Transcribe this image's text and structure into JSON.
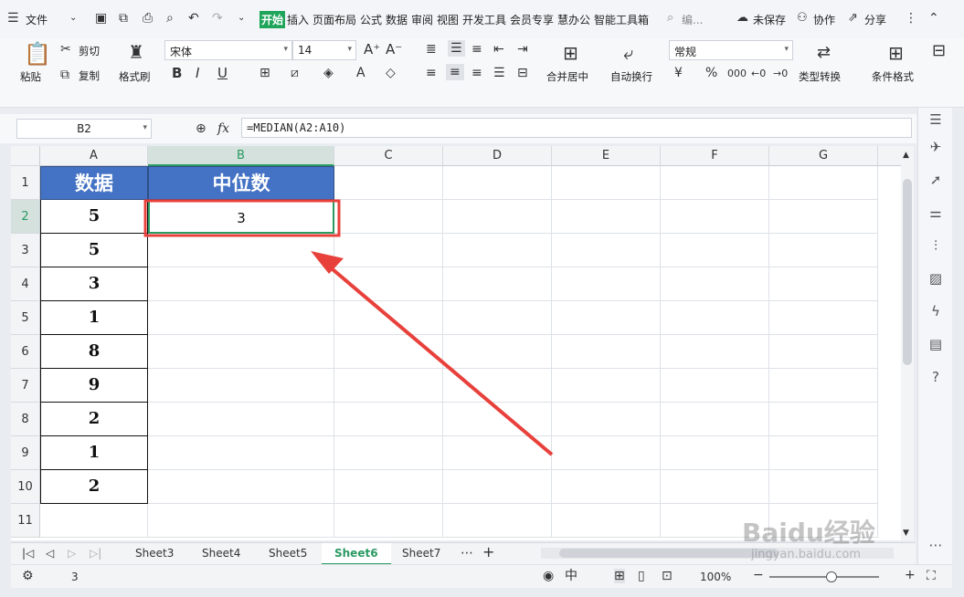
{
  "menubar": {
    "file_label": "文件",
    "tabs": [
      "开始",
      "插入",
      "页面布局",
      "公式",
      "数据",
      "审阅",
      "视图",
      "开发工具",
      "会员专享",
      "慧办公",
      "智能工具箱"
    ],
    "search_label": "编...",
    "unsaved_label": "未保存",
    "collab_label": "协作",
    "share_label": "分享"
  },
  "ribbon": {
    "paste": "粘贴",
    "cut": "剪切",
    "copy": "复制",
    "format_painter": "格式刷",
    "font_name": "宋体",
    "font_size": "14",
    "bold": "B",
    "italic": "I",
    "underline": "U",
    "merge_center": "合并居中",
    "wrap_text": "自动换行",
    "number_format": "常规",
    "currency": "¥",
    "percent": "%",
    "thousands": "000",
    "type_convert": "类型转换",
    "cond_format": "条件格式"
  },
  "formula": {
    "name_box": "B2",
    "fx": "fx",
    "value": "=MEDIAN(A2:A10)"
  },
  "grid": {
    "columns": [
      "A",
      "B",
      "C",
      "D",
      "E",
      "F",
      "G"
    ],
    "rows": [
      "1",
      "2",
      "3",
      "4",
      "5",
      "6",
      "7",
      "8",
      "9",
      "10",
      "11"
    ],
    "header_a": "数据",
    "header_b": "中位数",
    "data": [
      "5",
      "5",
      "3",
      "1",
      "8",
      "9",
      "2",
      "1",
      "2"
    ],
    "result": "3"
  },
  "sheets": {
    "tabs": [
      "Sheet3",
      "Sheet4",
      "Sheet5",
      "Sheet6",
      "Sheet7"
    ],
    "active": "Sheet6"
  },
  "status": {
    "value": "3",
    "zoom": "100%"
  },
  "watermark": {
    "brand": "Baidu经验",
    "url": "jingyan.baidu.com"
  },
  "colors": {
    "accent": "#2a9a63",
    "header_fill": "#4472c4",
    "highlight": "#e8413c"
  }
}
